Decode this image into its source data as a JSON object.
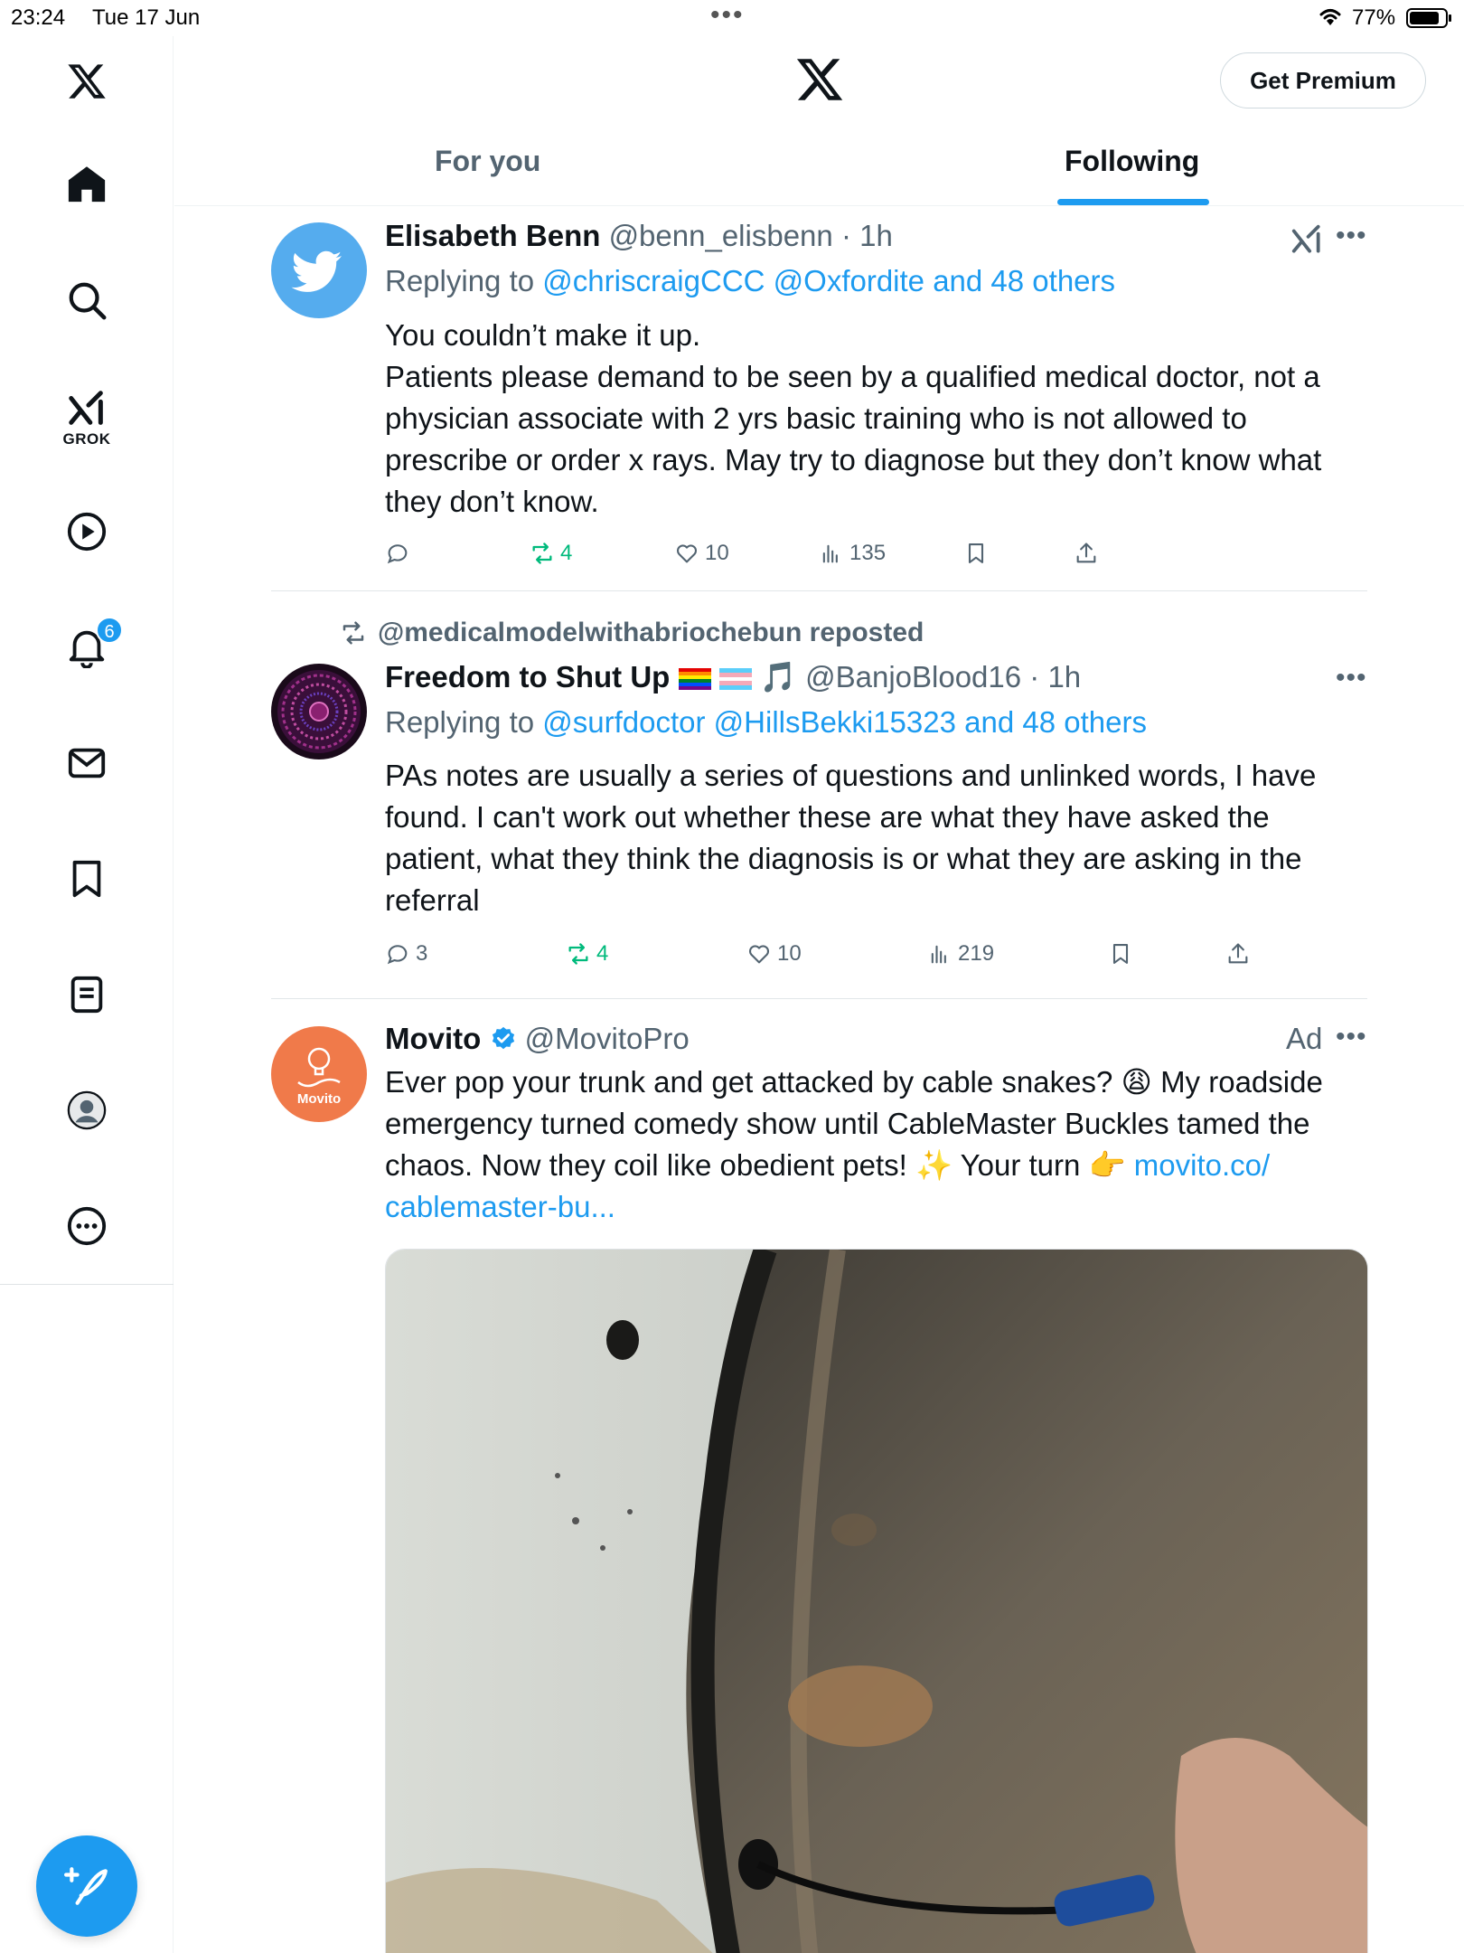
{
  "status_bar": {
    "time": "23:24",
    "date": "Tue 17 Jun",
    "battery": "77%"
  },
  "sidebar": {
    "items": [
      {
        "icon": "x-logo-icon"
      },
      {
        "icon": "home-icon"
      },
      {
        "icon": "search-icon"
      },
      {
        "icon": "grok-icon",
        "label": "GROK"
      },
      {
        "icon": "video-play-icon"
      },
      {
        "icon": "bell-icon",
        "badge": "6"
      },
      {
        "icon": "mail-icon"
      },
      {
        "icon": "bookmark-icon"
      },
      {
        "icon": "lists-icon"
      },
      {
        "icon": "profile-icon"
      },
      {
        "icon": "more-icon"
      }
    ],
    "compose_icon": "compose-icon"
  },
  "header": {
    "premium_label": "Get Premium",
    "tabs": [
      {
        "label": "For you",
        "active": false
      },
      {
        "label": "Following",
        "active": true
      }
    ]
  },
  "tweets": [
    {
      "name": "Elisabeth Benn",
      "handle": "@benn_elisbenn",
      "time": "· 1h",
      "reply_prefix": "Replying to",
      "reply_to": "@chriscraigCCC @Oxfordite and 48 others",
      "text": [
        "You couldn’t make it up.",
        "Patients please demand to be seen by a  qualified medical doctor, not a",
        "physician associate with 2 yrs  basic training who is not allowed to",
        "prescribe or order x rays. May try to diagnose but they don’t know what",
        "they don’t know."
      ],
      "replies": "",
      "reposts": "4",
      "likes": "10",
      "views": "135"
    },
    {
      "reposted_by": "@medicalmodelwithabriochebun reposted",
      "name": "Freedom to Shut Up",
      "name_emoji": "🎵",
      "handle": "@BanjoBlood16",
      "time": "· 1h",
      "reply_prefix": "Replying to",
      "reply_to": "@surfdoctor @HillsBekki15323 and 48 others",
      "text": [
        "PAs notes are usually a series of questions and unlinked words, I have",
        "found. I can't work out whether these are what they have asked the",
        "patient, what they think the diagnosis is or what they are asking in the",
        "referral"
      ],
      "replies": "3",
      "reposts": "4",
      "likes": "10",
      "views": "219"
    },
    {
      "name": "Movito",
      "handle": "@MovitoPro",
      "ad_label": "Ad",
      "avatar_text": "Movito",
      "text_lines": [
        "Ever pop your trunk and get attacked by cable snakes? 😩 My roadside",
        "emergency turned comedy show until CableMaster Buckles tamed the",
        "chaos. Now they coil like obedient pets! ✨ Your turn 👉 ",
        "cablemaster-bu..."
      ],
      "link_part": "movito.co/"
    }
  ],
  "colors": {
    "accent": "#1d9bf0",
    "repost_green": "#00ba7c",
    "muted": "#536471",
    "movito_orange": "#f07a4a"
  }
}
